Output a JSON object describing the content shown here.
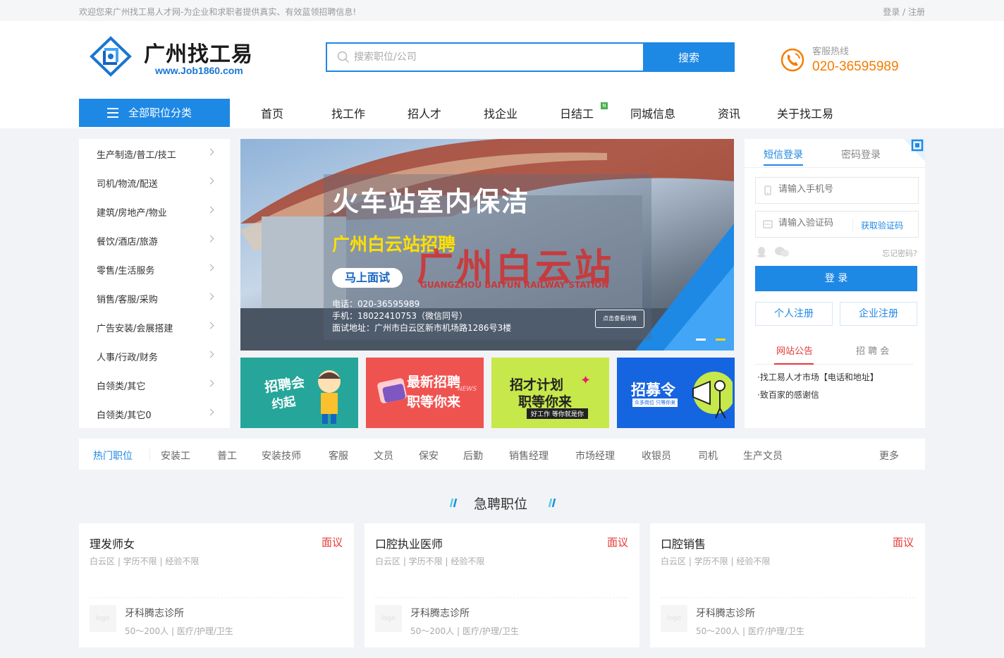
{
  "topbar": {
    "welcome": "欢迎您来广州找工易人才网-为企业和求职者提供真实、有效蓝领招聘信息!",
    "login": "登录",
    "sep": " / ",
    "register": "注册"
  },
  "header": {
    "logo_title": "广州找工易",
    "logo_url": "www.Job1860.com",
    "search_placeholder": "搜索职位/公司",
    "search_button": "搜索",
    "hotline_label": "客服热线",
    "hotline_number": "020-36595989"
  },
  "nav": {
    "category_button": "全部职位分类",
    "items": [
      "首页",
      "找工作",
      "招人才",
      "找企业",
      "日结工",
      "同城信息",
      "资讯",
      "关于找工易"
    ],
    "new_badge": "N"
  },
  "categories": [
    "生产制造/普工/技工",
    "司机/物流/配送",
    "建筑/房地产/物业",
    "餐饮/酒店/旅游",
    "零售/生活服务",
    "销售/客服/采购",
    "广告安装/会展搭建",
    "人事/行政/财务",
    "白领类/其它",
    "白领类/其它0"
  ],
  "banner": {
    "headline": "火车站室内保洁",
    "subhead": "广州白云站招聘",
    "cta": "马上面试",
    "phone": "电话：020-36595989",
    "mobile": "手机：18022410753（微信同号）",
    "address": "面试地址：广州市白云区新市机场路1286号3楼",
    "sign_cn": "广州白云站",
    "sign_en": "GUANGZHOU BAIYUN RAILWAY STATION",
    "detail_button": "点击查看详情"
  },
  "promos": [
    {
      "line1": "招聘会",
      "line2": "约起",
      "bg": "#26a69a"
    },
    {
      "line1": "最新招聘",
      "line2": "职等你来",
      "tag": "NEWS",
      "bg": "#ef5350"
    },
    {
      "line1": "招才计划",
      "line2": "职等你来",
      "line3": "好工作 等你就是你",
      "bg": "#c6e84a"
    },
    {
      "line1": "招募令",
      "line2": "众多岗位 只等你来",
      "bg": "#1565e0"
    }
  ],
  "login": {
    "tab_sms": "短信登录",
    "tab_password": "密码登录",
    "phone_placeholder": "请输入手机号",
    "code_placeholder": "请输入验证码",
    "get_code": "获取验证码",
    "forgot": "忘记密码?",
    "login_button": "登 录",
    "personal_register": "个人注册",
    "company_register": "企业注册",
    "notice_tab": "网站公告",
    "fair_tab": "招 聘 会",
    "notices": [
      "·找工易人才市场【电话和地址】",
      "·致百家的感谢信"
    ]
  },
  "hot_jobs": {
    "label": "热门职位",
    "items": [
      "安装工",
      "普工",
      "安装技师",
      "客服",
      "文员",
      "保安",
      "后勤",
      "销售经理",
      "市场经理",
      "收银员",
      "司机",
      "生产文员"
    ],
    "more": "更多"
  },
  "urgent": {
    "title": "急聘职位",
    "jobs": [
      {
        "title": "理发师女",
        "salary": "面议",
        "meta": "白云区 | 学历不限 | 经验不限",
        "company": "牙科腾志诊所",
        "company_meta": "50～200人 | 医疗/护理/卫生",
        "logo": "logo"
      },
      {
        "title": "口腔执业医师",
        "salary": "面议",
        "meta": "白云区 | 学历不限 | 经验不限",
        "company": "牙科腾志诊所",
        "company_meta": "50～200人 | 医疗/护理/卫生",
        "logo": "logo"
      },
      {
        "title": "口腔销售",
        "salary": "面议",
        "meta": "白云区 | 学历不限 | 经验不限",
        "company": "牙科腾志诊所",
        "company_meta": "50～200人 | 医疗/护理/卫生",
        "logo": "logo"
      }
    ]
  },
  "colors": {
    "brand": "#1e88e5",
    "accent": "#f57c00",
    "salary": "#e53935"
  }
}
